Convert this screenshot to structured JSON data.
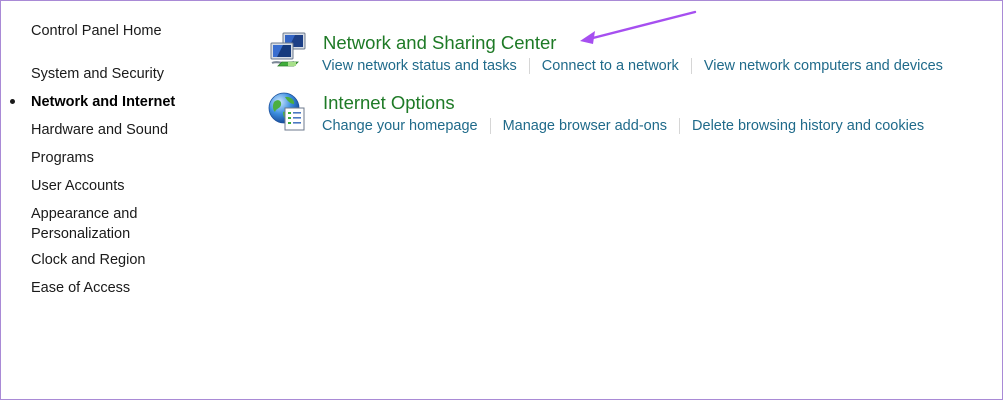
{
  "sidebar": {
    "home": "Control Panel Home",
    "items": [
      {
        "label": "System and Security"
      },
      {
        "label": "Network and Internet"
      },
      {
        "label": "Hardware and Sound"
      },
      {
        "label": "Programs"
      },
      {
        "label": "User Accounts"
      },
      {
        "label": "Appearance and Personalization"
      },
      {
        "label": "Clock and Region"
      },
      {
        "label": "Ease of Access"
      }
    ],
    "active_item": "Network and Internet"
  },
  "categories": [
    {
      "title": "Network and Sharing Center",
      "icon": "network-sharing-icon",
      "links": [
        "View network status and tasks",
        "Connect to a network",
        "View network computers and devices"
      ]
    },
    {
      "title": "Internet Options",
      "icon": "internet-options-icon",
      "links": [
        "Change your homepage",
        "Manage browser add-ons",
        "Delete browsing history and cookies"
      ]
    }
  ],
  "annotation": {
    "icon": "purple-arrow-icon",
    "color": "#a64ff0"
  },
  "colors": {
    "title_green": "#1e7a26",
    "link_blue": "#1f6a8a",
    "frame_border": "#a98ad6"
  }
}
